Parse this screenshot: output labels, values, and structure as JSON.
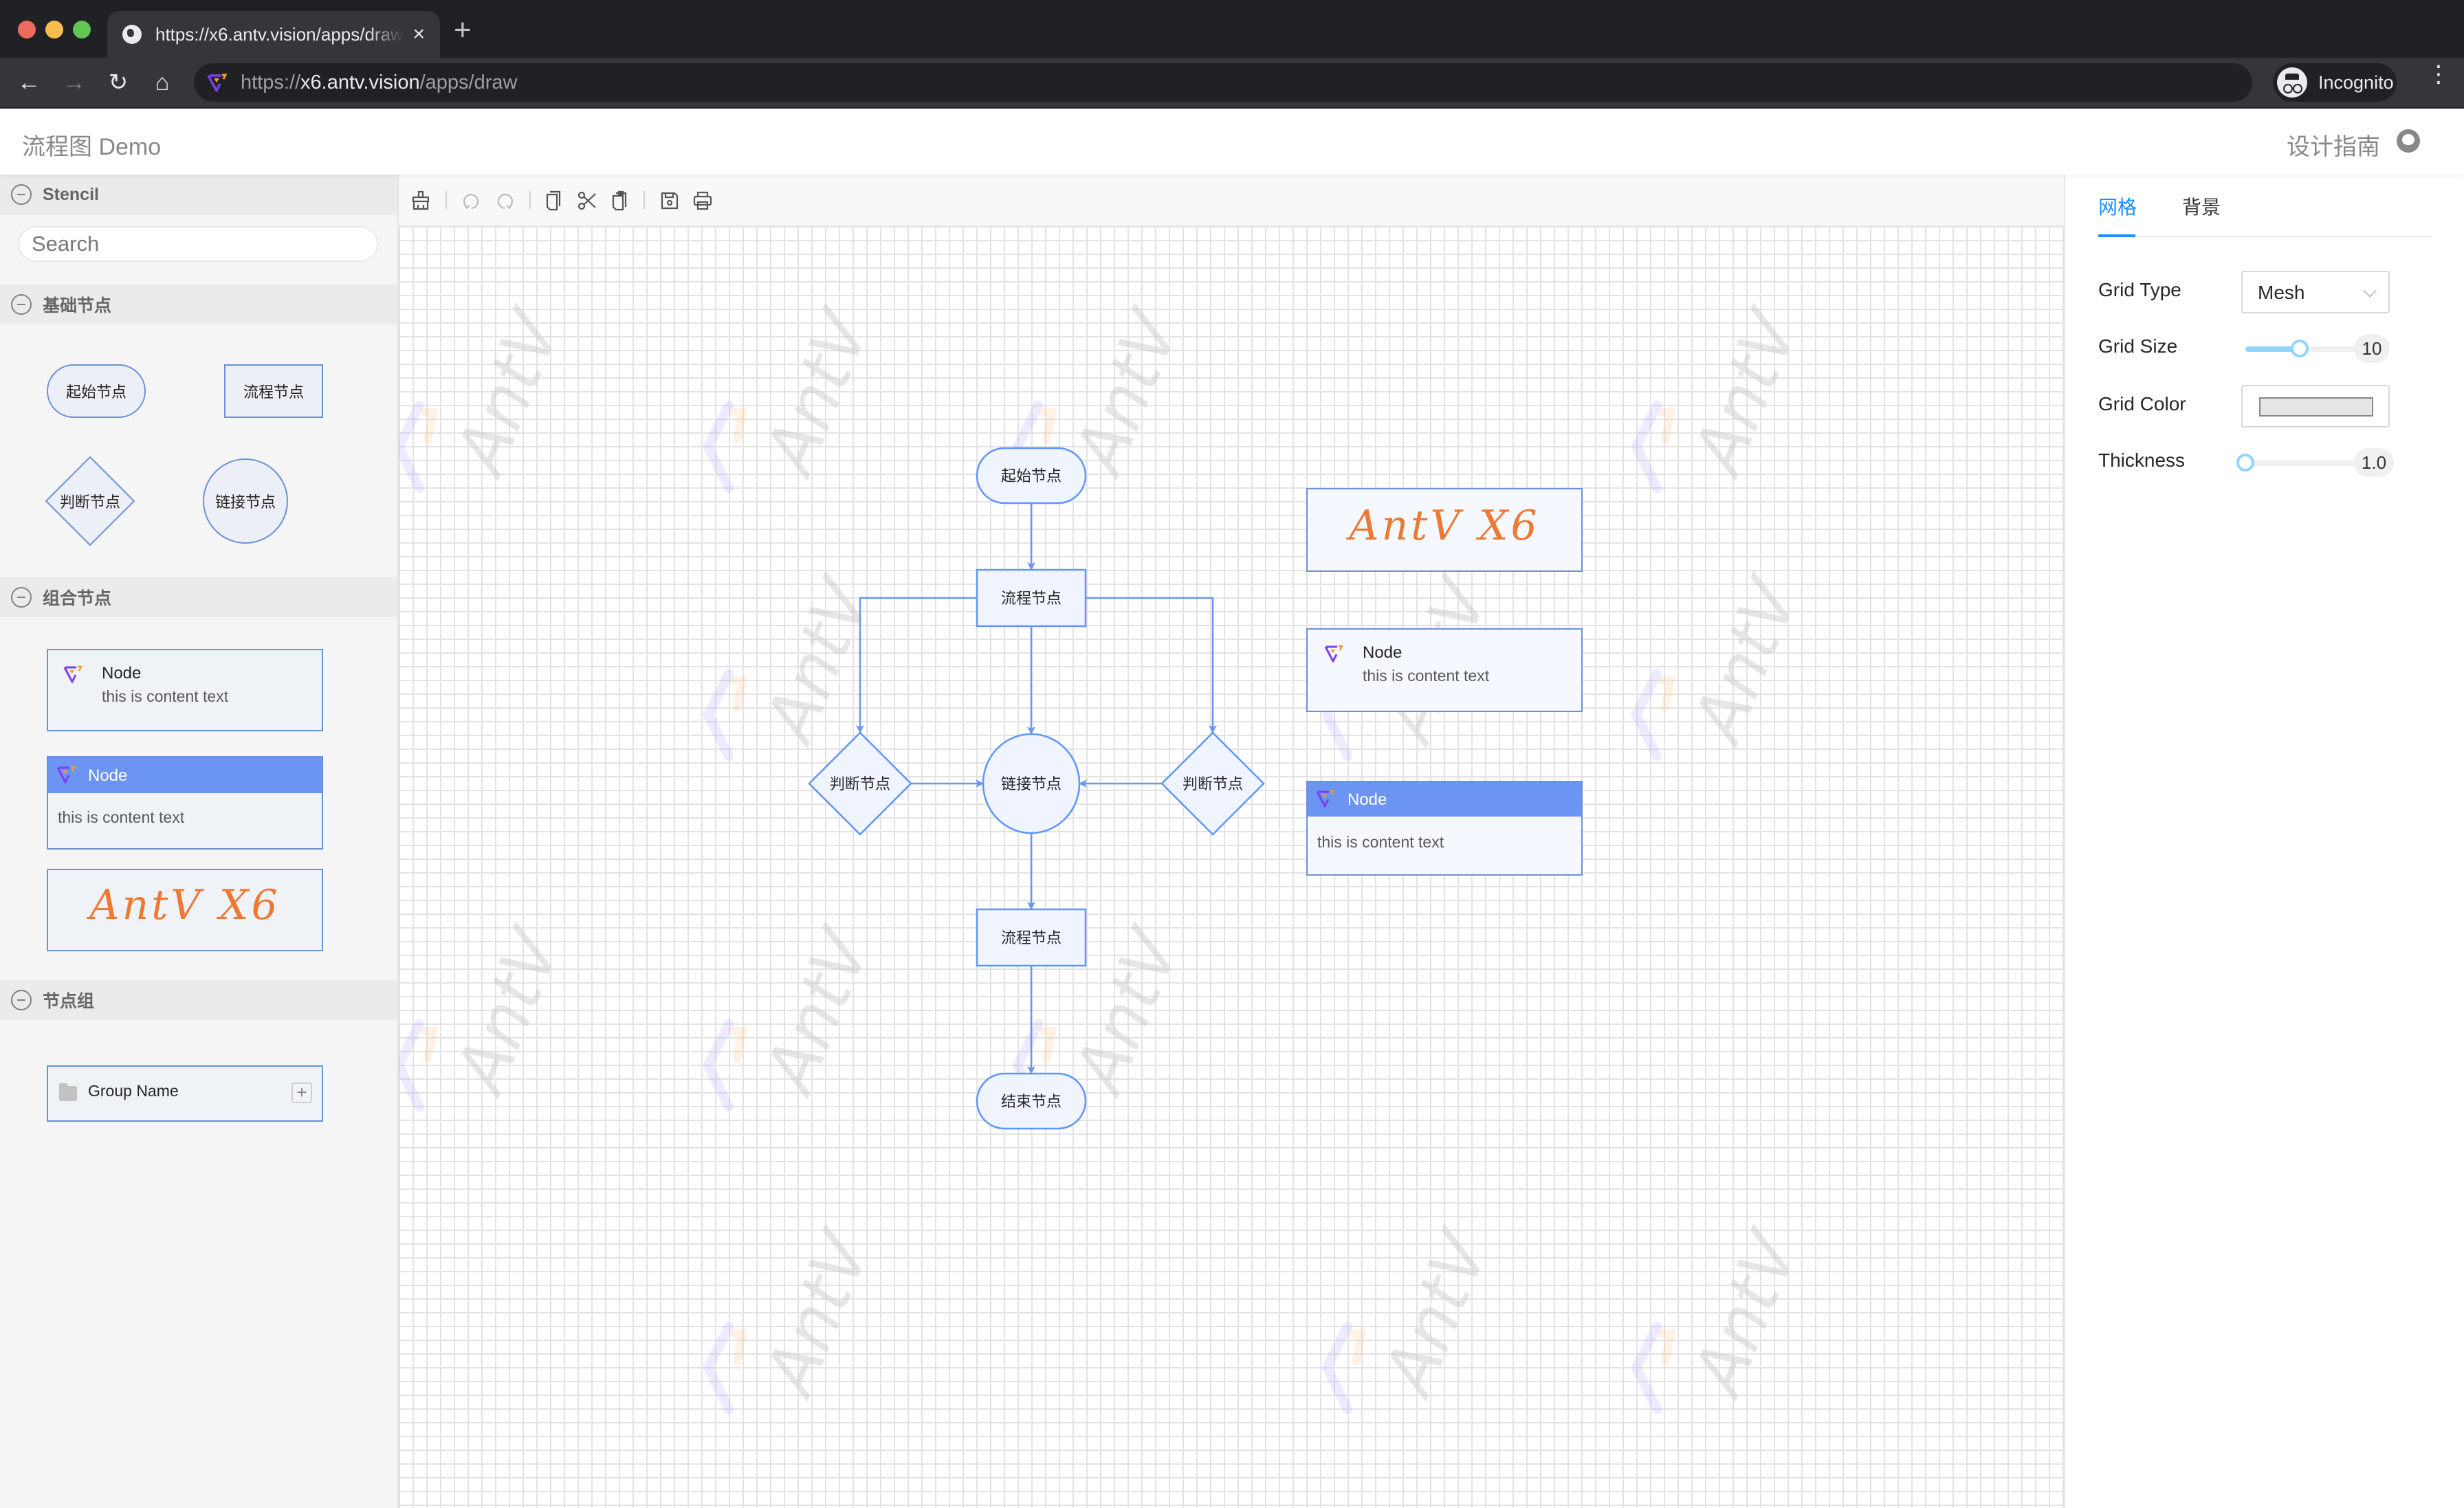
{
  "browser": {
    "tab_title": "https://x6.antv.vision/apps/draw",
    "tab_close": "×",
    "new_tab": "+",
    "url_scheme": "https://",
    "url_host": "x6.antv.vision",
    "url_path": "/apps/draw",
    "incognito_label": "Incognito",
    "nav_icons": {
      "back": "←",
      "forward": "→",
      "reload": "↻",
      "home": "⌂",
      "menu": "⋮"
    },
    "colors": {
      "chrome_bg": "#202124",
      "tab_bg": "#35363a"
    }
  },
  "header": {
    "title": "流程图 Demo",
    "guide_link": "设计指南",
    "github_icon": "github-icon"
  },
  "stencil": {
    "title": "Stencil",
    "search_placeholder": "Search",
    "groups": [
      {
        "title": "基础节点",
        "items": [
          {
            "shape": "ellipse",
            "label": "起始节点"
          },
          {
            "shape": "rect",
            "label": "流程节点"
          },
          {
            "shape": "diamond",
            "label": "判断节点"
          },
          {
            "shape": "circle",
            "label": "链接节点"
          }
        ]
      },
      {
        "title": "组合节点",
        "items": [
          {
            "type": "icon-card",
            "title": "Node",
            "text": "this is content text"
          },
          {
            "type": "header-card",
            "title": "Node",
            "text": "this is content text"
          },
          {
            "type": "logo-card",
            "text": "AntV X6"
          }
        ]
      },
      {
        "title": "节点组",
        "items": [
          {
            "type": "group",
            "name": "Group Name",
            "add": "+"
          }
        ]
      }
    ]
  },
  "toolbar": {
    "items": [
      {
        "name": "clear",
        "icon": "broom-icon",
        "enabled": true
      },
      {
        "name": "undo",
        "icon": "undo-icon",
        "enabled": false
      },
      {
        "name": "redo",
        "icon": "redo-icon",
        "enabled": false
      },
      {
        "name": "copy",
        "icon": "copy-icon",
        "enabled": true
      },
      {
        "name": "cut",
        "icon": "scissors-icon",
        "enabled": true
      },
      {
        "name": "paste",
        "icon": "paste-icon",
        "enabled": true
      },
      {
        "name": "save",
        "icon": "save-icon",
        "enabled": true
      },
      {
        "name": "print",
        "icon": "print-icon",
        "enabled": true
      }
    ]
  },
  "canvas": {
    "watermark": "AntV",
    "colors": {
      "node_stroke": "#5f95ff",
      "node_fill": "#eff4ff",
      "edge": "#6b95f0",
      "accent_orange": "#ec7a35"
    },
    "nodes": [
      {
        "id": "start",
        "shape": "ellipse",
        "label": "起始节点"
      },
      {
        "id": "process1",
        "shape": "rect",
        "label": "流程节点"
      },
      {
        "id": "decision-left",
        "shape": "diamond",
        "label": "判断节点"
      },
      {
        "id": "link",
        "shape": "circle",
        "label": "链接节点"
      },
      {
        "id": "decision-right",
        "shape": "diamond",
        "label": "判断节点"
      },
      {
        "id": "process2",
        "shape": "rect",
        "label": "流程节点"
      },
      {
        "id": "end",
        "shape": "ellipse",
        "label": "结束节点"
      }
    ],
    "edges": [
      {
        "from": "start",
        "to": "process1"
      },
      {
        "from": "process1",
        "to": "decision-left"
      },
      {
        "from": "process1",
        "to": "link"
      },
      {
        "from": "process1",
        "to": "decision-right"
      },
      {
        "from": "decision-left",
        "to": "link"
      },
      {
        "from": "decision-right",
        "to": "link"
      },
      {
        "from": "link",
        "to": "process2"
      },
      {
        "from": "process2",
        "to": "end"
      }
    ],
    "side_nodes": [
      {
        "type": "logo-card",
        "text": "AntV X6"
      },
      {
        "type": "icon-card",
        "title": "Node",
        "text": "this is content text"
      },
      {
        "type": "header-card",
        "title": "Node",
        "text": "this is content text"
      }
    ]
  },
  "panel": {
    "tabs": [
      {
        "label": "网格",
        "active": true
      },
      {
        "label": "背景",
        "active": false
      }
    ],
    "grid_type_label": "Grid Type",
    "grid_type_value": "Mesh",
    "grid_size_label": "Grid Size",
    "grid_size_value": "10",
    "grid_size_fraction": 0.45,
    "grid_color_label": "Grid Color",
    "grid_color_value": "#e5e5e5",
    "thickness_label": "Thickness",
    "thickness_value": "1.0",
    "thickness_fraction": 0.0,
    "accent": "#1890ff"
  }
}
